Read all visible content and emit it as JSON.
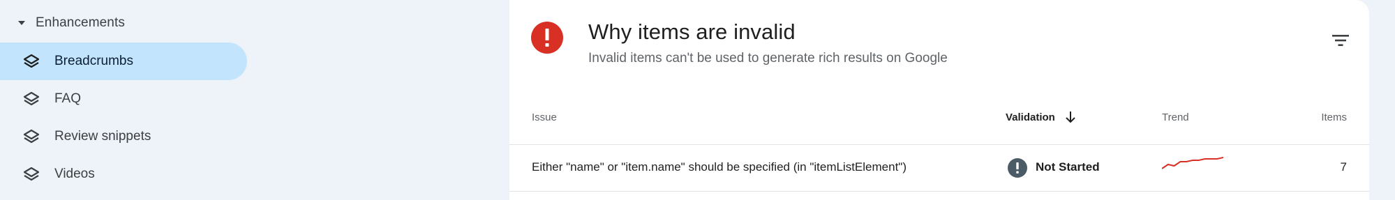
{
  "sidebar": {
    "section_label": "Enhancements",
    "items": [
      {
        "label": "Breadcrumbs",
        "icon": "layers-icon",
        "active": true
      },
      {
        "label": "FAQ",
        "icon": "layers-icon",
        "active": false
      },
      {
        "label": "Review snippets",
        "icon": "layers-icon",
        "active": false
      },
      {
        "label": "Videos",
        "icon": "layers-icon",
        "active": false
      }
    ]
  },
  "card": {
    "title": "Why items are invalid",
    "subtitle": "Invalid items can't be used to generate rich results on Google",
    "icon": "error-icon",
    "icon_color": "#d93025",
    "table": {
      "columns": [
        "Issue",
        "Validation",
        "Trend",
        "Items"
      ],
      "sorted_column": "Validation",
      "rows": [
        {
          "issue": "Either \"name\" or \"item.name\" should be specified (in \"itemListElement\")",
          "validation": "Not Started",
          "trend_values": [
            2,
            5,
            4,
            7,
            7,
            8,
            8,
            9,
            9,
            9,
            10
          ],
          "items": "7"
        }
      ]
    }
  },
  "colors": {
    "page_bg": "#eef2f9",
    "active_nav": "#c2e5fd",
    "error": "#d93025",
    "status_icon": "#4b5c66",
    "trend": "#d93025"
  }
}
